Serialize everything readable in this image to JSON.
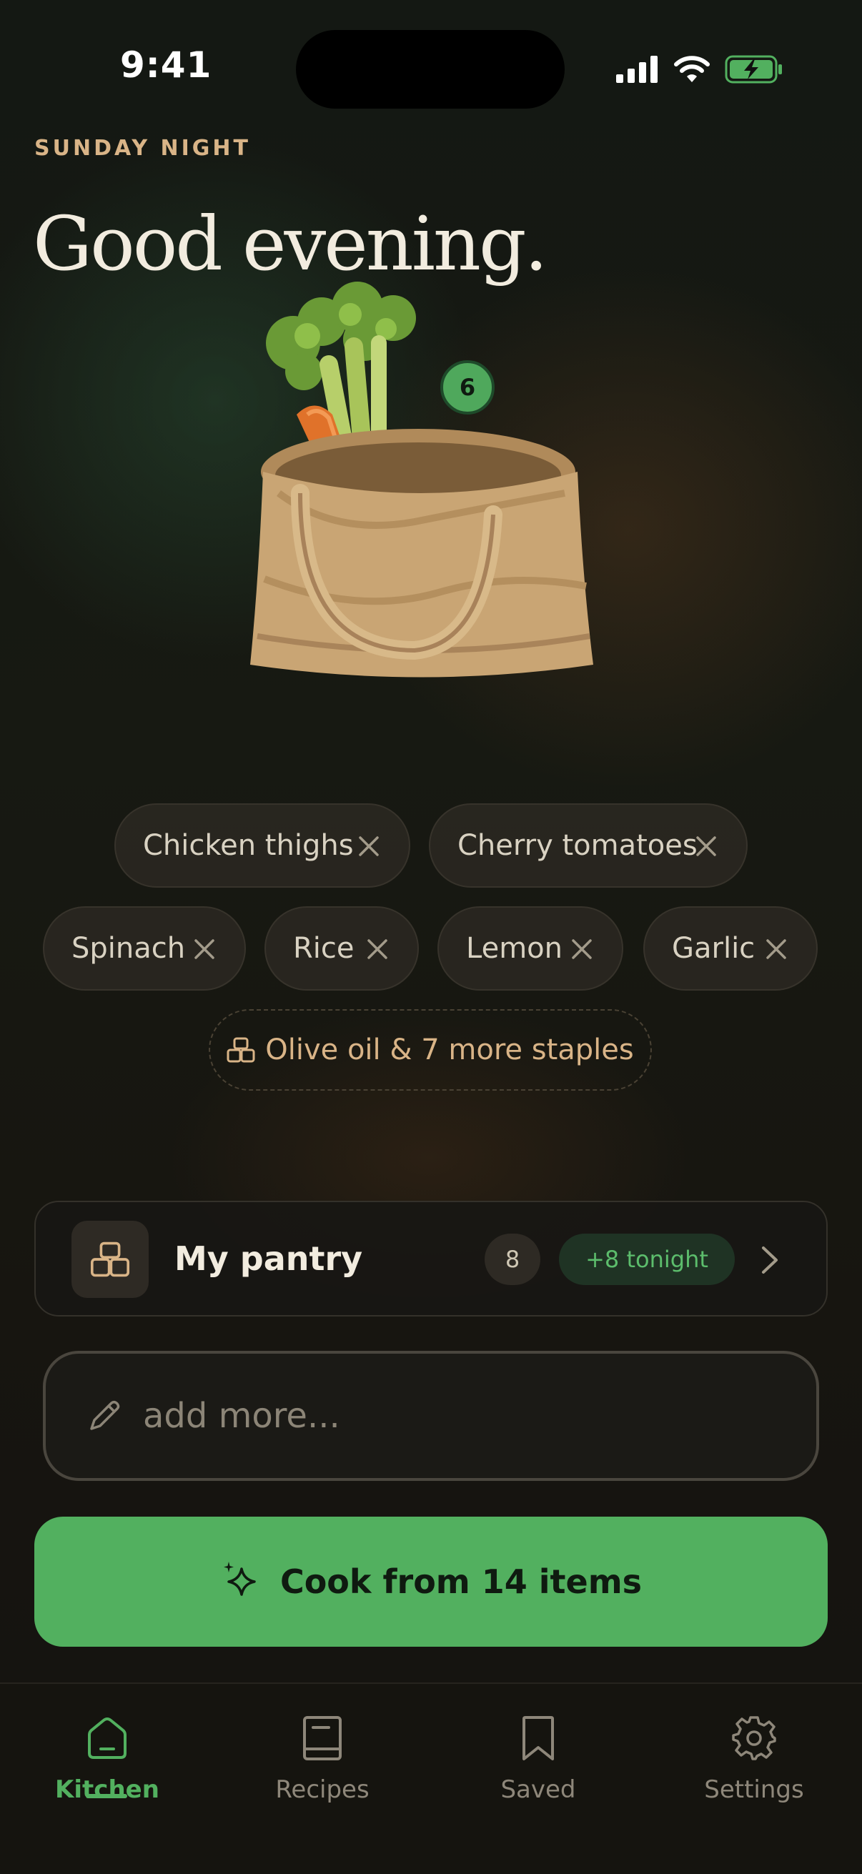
{
  "status_bar": {
    "time": "9:41"
  },
  "header": {
    "eyebrow": "SUNDAY NIGHT",
    "greeting": "Good evening."
  },
  "bag": {
    "badge_count": "6"
  },
  "ingredients": [
    {
      "label": "Chicken thighs"
    },
    {
      "label": "Cherry tomatoes"
    },
    {
      "label": "Spinach"
    },
    {
      "label": "Rice"
    },
    {
      "label": "Lemon"
    },
    {
      "label": "Garlic"
    }
  ],
  "staples": {
    "label": "Olive oil & 7 more staples",
    "icon": "pantry-jars-icon"
  },
  "pantry": {
    "title": "My pantry",
    "count": "8",
    "tonight": "+8 tonight"
  },
  "input": {
    "placeholder": "add more..."
  },
  "cta": {
    "label": "Cook from 14 items",
    "icon": "sparkle-icon"
  },
  "tabs": [
    {
      "label": "Kitchen",
      "icon": "home-icon",
      "active": true
    },
    {
      "label": "Recipes",
      "icon": "book-icon"
    },
    {
      "label": "Saved",
      "icon": "bookmark-icon"
    },
    {
      "label": "Settings",
      "icon": "gear-icon"
    }
  ],
  "colors": {
    "accent": "#52b05f",
    "eyebrow": "#d9b487",
    "background": "#16150f"
  }
}
